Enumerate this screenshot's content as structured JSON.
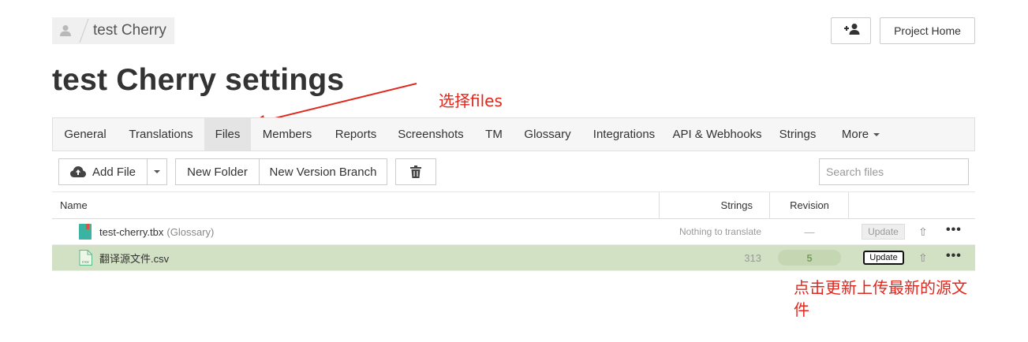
{
  "breadcrumb": {
    "project": "test Cherry"
  },
  "header": {
    "project_home": "Project Home"
  },
  "page": {
    "title": "test Cherry settings"
  },
  "tabs": [
    {
      "label": "General"
    },
    {
      "label": "Translations"
    },
    {
      "label": "Files",
      "active": true
    },
    {
      "label": "Members"
    },
    {
      "label": "Reports"
    },
    {
      "label": "Screenshots"
    },
    {
      "label": "TM"
    },
    {
      "label": "Glossary"
    },
    {
      "label": "Integrations"
    },
    {
      "label": "API & Webhooks"
    },
    {
      "label": "Strings"
    },
    {
      "label": "More"
    }
  ],
  "toolbar": {
    "add_file": "Add File",
    "new_folder": "New Folder",
    "new_version_branch": "New Version Branch",
    "search_placeholder": "Search files"
  },
  "table": {
    "headers": {
      "name": "Name",
      "strings": "Strings",
      "revision": "Revision"
    },
    "rows": [
      {
        "name": "test-cherry.tbx",
        "tag": "(Glossary)",
        "strings": "Nothing to translate",
        "revision": "—",
        "action": "Update",
        "icon": "glossary-book-icon"
      },
      {
        "name": "翻译源文件.csv",
        "tag": "",
        "strings": "313",
        "revision": "5",
        "action": "Update",
        "icon": "csv-file-icon",
        "selected": true
      }
    ]
  },
  "annotations": {
    "select_files": "选择files",
    "click_update_line1": "点击更新上传最新的源文",
    "click_update_line2": "件"
  },
  "colors": {
    "annotation_red": "#e3261c",
    "selected_row": "#d2e0c3",
    "accent_teal": "#3bb3a3"
  }
}
